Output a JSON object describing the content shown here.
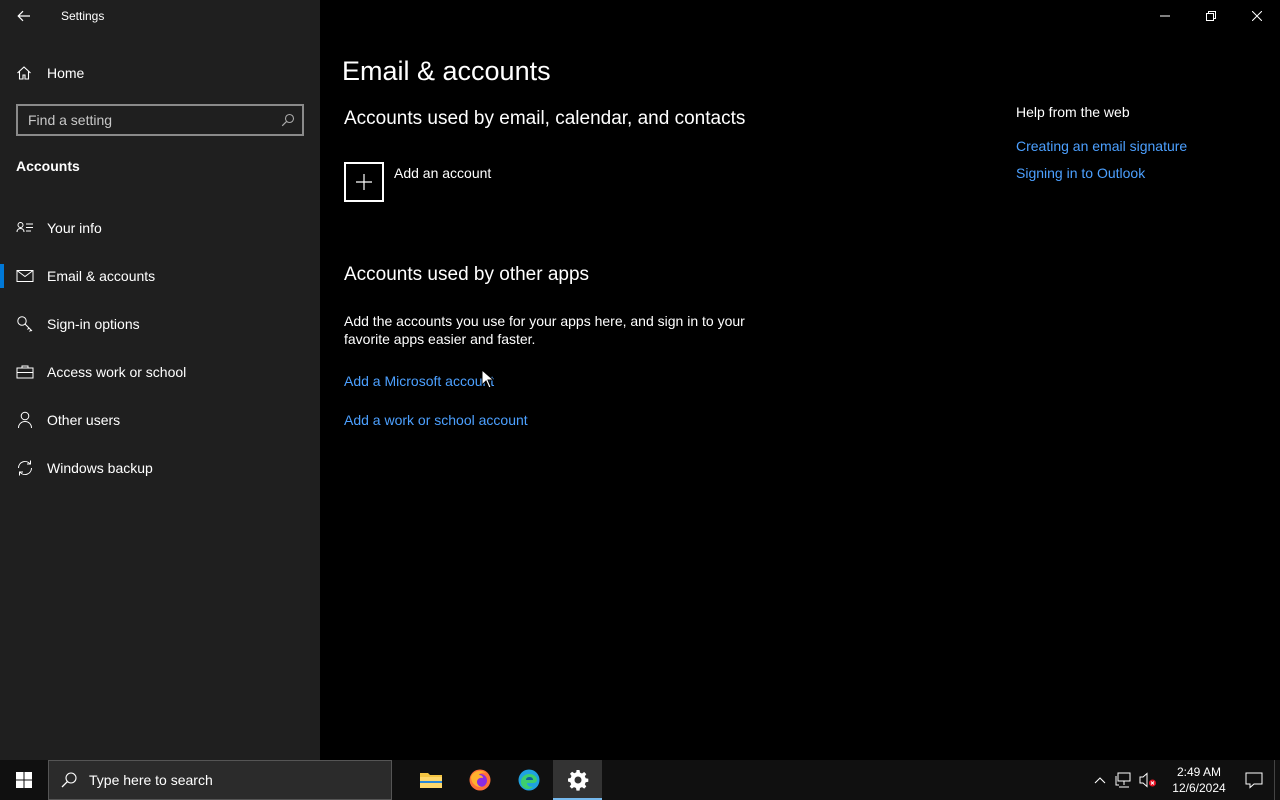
{
  "window": {
    "title": "Settings"
  },
  "sidebar": {
    "home_label": "Home",
    "search_placeholder": "Find a setting",
    "section_label": "Accounts",
    "items": [
      {
        "label": "Your info",
        "icon": "person-card-icon"
      },
      {
        "label": "Email & accounts",
        "icon": "mail-icon",
        "selected": true
      },
      {
        "label": "Sign-in options",
        "icon": "key-icon"
      },
      {
        "label": "Access work or school",
        "icon": "briefcase-icon"
      },
      {
        "label": "Other users",
        "icon": "person-icon"
      },
      {
        "label": "Windows backup",
        "icon": "sync-icon"
      }
    ]
  },
  "main": {
    "title": "Email & accounts",
    "email_section": {
      "heading": "Accounts used by email, calendar, and contacts",
      "add_label": "Add an account"
    },
    "other_section": {
      "heading": "Accounts used by other apps",
      "description": "Add the accounts you use for your apps here, and sign in to your favorite apps easier and faster.",
      "link_microsoft": "Add a Microsoft account",
      "link_work": "Add a work or school account"
    }
  },
  "help": {
    "title": "Help from the web",
    "links": [
      "Creating an email signature",
      "Signing in to Outlook"
    ]
  },
  "taskbar": {
    "search_placeholder": "Type here to search",
    "time": "2:49 AM",
    "date": "12/6/2024"
  },
  "colors": {
    "accent": "#0078d7",
    "link": "#4ca0ff",
    "sidebar_bg": "#1f1f1f",
    "main_bg": "#000000"
  }
}
